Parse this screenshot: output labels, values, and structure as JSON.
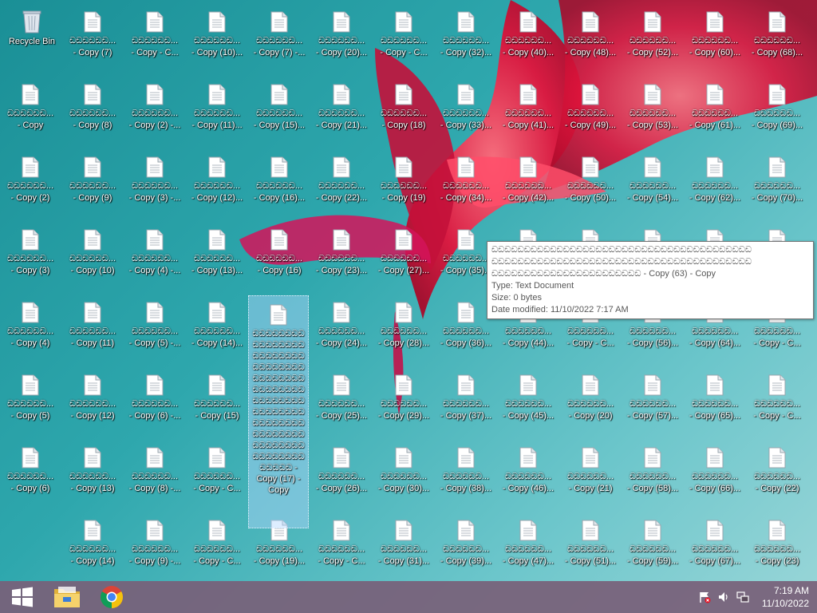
{
  "desktop": {
    "recycle_bin_label": "Recycle Bin",
    "columns": [
      [
        "ඩඩඩඩඩඩ...\n- Copy",
        "ඩඩඩඩඩඩ...\n- Copy (2)",
        "ඩඩඩඩඩඩ...\n- Copy (3)",
        "ඩඩඩඩඩඩ...\n- Copy (4)",
        "ඩඩඩඩඩඩ...\n- Copy (5)",
        "ඩඩඩඩඩඩ...\n- Copy (6)"
      ],
      [
        "ඩඩඩඩඩඩ...\n- Copy (7)",
        "ඩඩඩඩඩඩ...\n- Copy (8)",
        "ඩඩඩඩඩඩ...\n- Copy (9)",
        "ඩඩඩඩඩඩ...\n- Copy (10)",
        "ඩඩඩඩඩඩ...\n- Copy (11)",
        "ඩඩඩඩඩඩ...\n- Copy (12)",
        "ඩඩඩඩඩඩ...\n- Copy (13)",
        "ඩඩඩඩඩඩ...\n- Copy (14)"
      ],
      [
        "ඩඩඩඩඩඩ...\n- Copy - C...",
        "ඩඩඩඩඩඩ...\n- Copy (2) -...",
        "ඩඩඩඩඩඩ...\n- Copy (3) -...",
        "ඩඩඩඩඩඩ...\n- Copy (4) -...",
        "ඩඩඩඩඩඩ...\n- Copy (5) -...",
        "ඩඩඩඩඩඩ...\n- Copy (6) -...",
        "ඩඩඩඩඩඩ...\n- Copy (8) -...",
        "ඩඩඩඩඩඩ...\n- Copy (9) -..."
      ],
      [
        "ඩඩඩඩඩඩ...\n- Copy (10)...",
        "ඩඩඩඩඩඩ...\n- Copy (11)...",
        "ඩඩඩඩඩඩ...\n- Copy (12)...",
        "ඩඩඩඩඩඩ...\n- Copy (13)...",
        "ඩඩඩඩඩඩ...\n- Copy (14)...",
        "ඩඩඩඩඩඩ...\n- Copy (15)",
        "ඩඩඩඩඩඩ...\n- Copy - C...",
        "ඩඩඩඩඩඩ...\n- Copy - C..."
      ],
      [
        "ඩඩඩඩඩඩ...\n- Copy (7) -...",
        "ඩඩඩඩඩඩ...\n- Copy (15)...",
        "ඩඩඩඩඩඩ...\n- Copy (16)...",
        "ඩඩඩඩඩඩ...\n- Copy (16)",
        "ඩඩඩඩඩඩ...\n- Copy (19)..."
      ],
      [
        "ඩඩඩඩඩඩ...\n- Copy (20)...",
        "ඩඩඩඩඩඩ...\n- Copy (21)...",
        "ඩඩඩඩඩඩ...\n- Copy (22)...",
        "ඩඩඩඩඩඩ...\n- Copy (23)...",
        "ඩඩඩඩඩඩ...\n- Copy (24)...",
        "ඩඩඩඩඩඩ...\n- Copy (25)...",
        "ඩඩඩඩඩඩ...\n- Copy (26)...",
        "ඩඩඩඩඩඩ...\n- Copy - C..."
      ],
      [
        "ඩඩඩඩඩඩ...\n- Copy - C...",
        "ඩඩඩඩඩඩ...\n- Copy (18)",
        "ඩඩඩඩඩඩ...\n- Copy (19)",
        "ඩඩඩඩඩඩ...\n- Copy (27)...",
        "ඩඩඩඩඩඩ...\n- Copy (28)...",
        "ඩඩඩඩඩඩ...\n- Copy (29)...",
        "ඩඩඩඩඩඩ...\n- Copy (30)...",
        "ඩඩඩඩඩඩ...\n- Copy (31)..."
      ],
      [
        "ඩඩඩඩඩඩ...\n- Copy (32)...",
        "ඩඩඩඩඩඩ...\n- Copy (33)...",
        "ඩඩඩඩඩඩ...\n- Copy (34)...",
        "ඩඩඩඩඩඩ...\n- Copy (35)...",
        "ඩඩඩඩඩඩ...\n- Copy (36)...",
        "ඩඩඩඩඩඩ...\n- Copy (37)...",
        "ඩඩඩඩඩඩ...\n- Copy (38)...",
        "ඩඩඩඩඩඩ...\n- Copy (39)..."
      ],
      [
        "ඩඩඩඩඩඩ...\n- Copy (40)...",
        "ඩඩඩඩඩඩ...\n- Copy (41)...",
        "ඩඩඩඩඩඩ...\n- Copy (42)...",
        "ඩඩඩඩඩඩ...\n- Copy (43)...",
        "ඩඩඩඩඩඩ...\n- Copy (44)...",
        "ඩඩඩඩඩඩ...\n- Copy (45)...",
        "ඩඩඩඩඩඩ...\n- Copy (46)...",
        "ඩඩඩඩඩඩ...\n- Copy (47)..."
      ],
      [
        "ඩඩඩඩඩඩ...\n- Copy (48)...",
        "ඩඩඩඩඩඩ...\n- Copy (49)...",
        "ඩඩඩඩඩඩ...\n- Copy (50)...",
        "ඩඩඩඩඩඩ...\n- Copy (20)",
        "ඩඩඩඩඩඩ...\n- Copy - C...",
        "ඩඩඩඩඩඩ...\n- Copy (20)",
        "ඩඩඩඩඩඩ...\n- Copy (21)",
        "ඩඩඩඩඩඩ...\n- Copy (51)..."
      ],
      [
        "ඩඩඩඩඩඩ...\n- Copy (52)...",
        "ඩඩඩඩඩඩ...\n- Copy (53)...",
        "ඩඩඩඩඩඩ...\n- Copy (54)...",
        "ඩඩඩඩඩඩ...\n- Copy (55)...",
        "ඩඩඩඩඩඩ...\n- Copy (56)...",
        "ඩඩඩඩඩඩ...\n- Copy (57)...",
        "ඩඩඩඩඩඩ...\n- Copy (58)...",
        "ඩඩඩඩඩඩ...\n- Copy (59)..."
      ],
      [
        "ඩඩඩඩඩඩ...\n- Copy (60)...",
        "ඩඩඩඩඩඩ...\n- Copy (61)...",
        "ඩඩඩඩඩඩ...\n- Copy (62)...",
        "ඩඩඩඩඩඩ...\n- Copy (63)...",
        "ඩඩඩඩඩඩ...\n- Copy (64)...",
        "ඩඩඩඩඩඩ...\n- Copy (65)...",
        "ඩඩඩඩඩඩ...\n- Copy (66)...",
        "ඩඩඩඩඩඩ...\n- Copy (67)..."
      ],
      [
        "ඩඩඩඩඩඩ...\n- Copy (68)...",
        "ඩඩඩඩඩඩ...\n- Copy (69)...",
        "ඩඩඩඩඩඩ...\n- Copy (70)...",
        "ඩඩඩඩඩඩ...\n- Copy (71)...",
        "ඩඩඩඩඩඩ...\n- Copy - C...",
        "ඩඩඩඩඩඩ...\n- Copy - C...",
        "ඩඩඩඩඩඩ...\n- Copy (22)",
        "ඩඩඩඩඩඩ...\n- Copy (23)"
      ]
    ],
    "selected_label": "ඩඩඩඩඩඩඩඩ\nඩඩඩඩඩඩඩඩ\nඩඩඩඩඩඩඩඩ\nඩඩඩඩඩඩඩඩ\nඩඩඩඩඩඩඩඩ\nඩඩඩඩඩඩඩඩ\nඩඩඩඩඩඩඩඩ\nඩඩඩඩඩඩඩඩ\nඩඩඩඩඩඩඩඩ\nඩඩඩඩඩඩඩඩ\nඩඩඩඩඩඩඩඩ\nඩඩඩඩඩඩඩඩ\nඩඩඩඩඩ -\nCopy (17) -\nCopy"
  },
  "tooltip": {
    "name_line1": "ඩඩඩඩඩඩඩඩඩඩඩඩඩඩඩඩඩඩඩඩඩඩඩඩඩඩඩඩඩඩඩඩඩඩඩඩඩඩඩඩ",
    "name_line2": "ඩඩඩඩඩඩඩඩඩඩඩඩඩඩඩඩඩඩඩඩඩඩඩඩඩඩඩඩඩඩඩඩඩඩඩඩඩඩඩඩ",
    "name_line3": "ඩඩඩඩඩඩඩඩඩඩඩඩඩඩඩඩඩඩඩඩඩඩඩ - Copy (63) - Copy",
    "type": "Type: Text Document",
    "size": "Size: 0 bytes",
    "modified": "Date modified: 11/10/2022 7:17 AM"
  },
  "taskbar": {
    "time": "7:19 AM",
    "date": "11/10/2022",
    "colors": {
      "start": "#ffffff",
      "folder": "#f2c94c",
      "chrome_red": "#db4437",
      "chrome_yellow": "#f4c20d",
      "chrome_green": "#0f9d58",
      "chrome_blue": "#4285f4"
    }
  }
}
